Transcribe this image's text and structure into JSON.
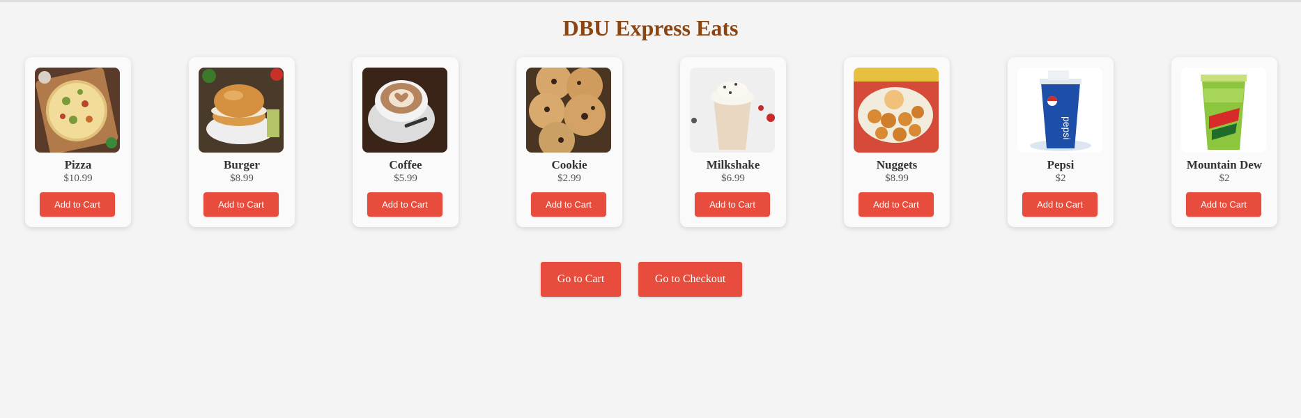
{
  "header": {
    "title": "DBU Express Eats"
  },
  "products": [
    {
      "name": "Pizza",
      "price": "$10.99",
      "button": "Add to Cart",
      "image": "pizza-image"
    },
    {
      "name": "Burger",
      "price": "$8.99",
      "button": "Add to Cart",
      "image": "burger-image"
    },
    {
      "name": "Coffee",
      "price": "$5.99",
      "button": "Add to Cart",
      "image": "coffee-image"
    },
    {
      "name": "Cookie",
      "price": "$2.99",
      "button": "Add to Cart",
      "image": "cookie-image"
    },
    {
      "name": "Milkshake",
      "price": "$6.99",
      "button": "Add to Cart",
      "image": "milkshake-image"
    },
    {
      "name": "Nuggets",
      "price": "$8.99",
      "button": "Add to Cart",
      "image": "nuggets-image"
    },
    {
      "name": "Pepsi",
      "price": "$2",
      "button": "Add to Cart",
      "image": "pepsi-image"
    },
    {
      "name": "Mountain Dew",
      "price": "$2",
      "button": "Add to Cart",
      "image": "mountain-dew-image"
    }
  ],
  "actions": {
    "cart_label": "Go to Cart",
    "checkout_label": "Go to Checkout"
  },
  "colors": {
    "accent": "#e74c3c",
    "title": "#8b4513",
    "background": "#f4f4f4"
  }
}
